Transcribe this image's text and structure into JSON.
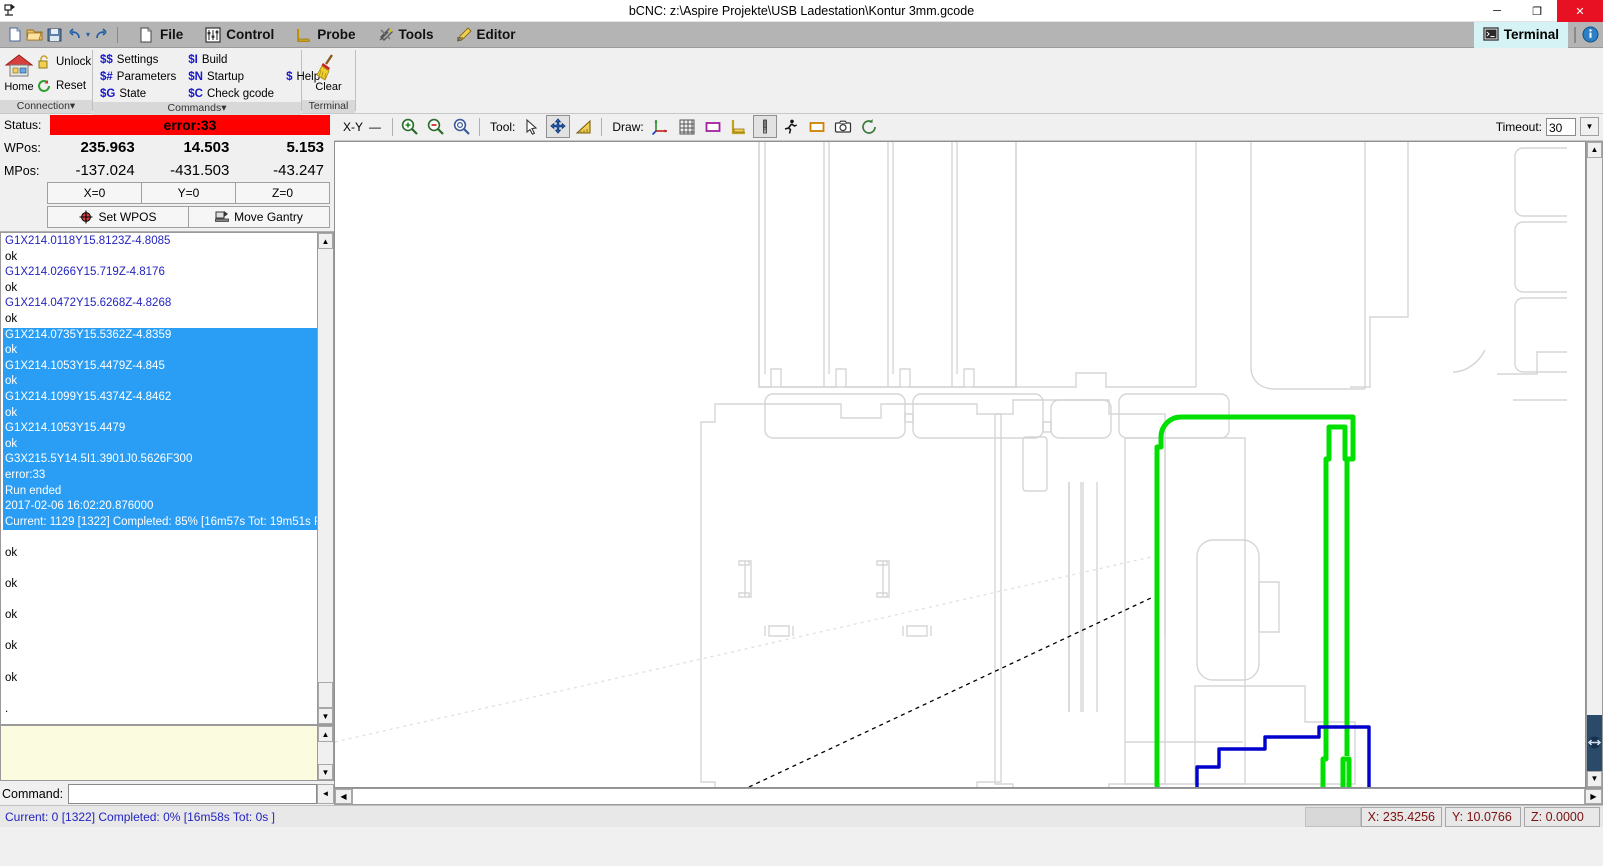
{
  "window": {
    "title": "bCNC: z:\\Aspire Projekte\\USB Ladestation\\Kontur 3mm.gcode",
    "minimize": "─",
    "maximize": "❐",
    "close": "✕"
  },
  "quick_access": {
    "new": "new-file",
    "open": "open-folder",
    "save": "save-disk",
    "undo": "undo-arrow",
    "undo_dropdown": "▾",
    "redo": "redo-arrow"
  },
  "menu_tabs": [
    {
      "label": "File",
      "icon": "page-icon"
    },
    {
      "label": "Control",
      "icon": "sliders-icon"
    },
    {
      "label": "Probe",
      "icon": "ruler-icon"
    },
    {
      "label": "Tools",
      "icon": "wrench-screwdriver-icon"
    },
    {
      "label": "Editor",
      "icon": "pencil-icon"
    }
  ],
  "terminal_tab": {
    "label": "Terminal",
    "icon": "terminal-icon",
    "info_icon": "info-icon"
  },
  "ribbon": {
    "connection": {
      "group_label": "Connection",
      "group_arrow": "▾",
      "home": "Home",
      "unlock": "Unlock",
      "reset": "Reset"
    },
    "commands": {
      "group_label": "Commands",
      "group_arrow": "▾",
      "items": [
        {
          "prefix": "$$",
          "label": "Settings"
        },
        {
          "prefix": "$#",
          "label": "Parameters"
        },
        {
          "prefix": "$G",
          "label": "State"
        },
        {
          "prefix": "$I",
          "label": "Build"
        },
        {
          "prefix": "$N",
          "label": "Startup"
        },
        {
          "prefix": "$C",
          "label": "Check gcode"
        },
        {
          "prefix": "$",
          "label": "Help"
        }
      ]
    },
    "terminal": {
      "group_label": "Terminal",
      "clear": "Clear"
    }
  },
  "status_panel": {
    "status_label": "Status:",
    "status_value": "error:33",
    "status_color": "#ff0000",
    "wpos_label": "WPos:",
    "wpos": [
      "235.963",
      "14.503",
      "5.153"
    ],
    "mpos_label": "MPos:",
    "mpos": [
      "-137.024",
      "-431.503",
      "-43.247"
    ],
    "zero_buttons": [
      "X=0",
      "Y=0",
      "Z=0"
    ],
    "set_wpos": "Set WPOS",
    "move_gantry": "Move Gantry"
  },
  "terminal_log": [
    {
      "text": "G1X214.0118Y15.8123Z-4.8085",
      "type": "gcode",
      "selected": false
    },
    {
      "text": "ok",
      "type": "ok",
      "selected": false
    },
    {
      "text": "G1X214.0266Y15.719Z-4.8176",
      "type": "gcode",
      "selected": false
    },
    {
      "text": "ok",
      "type": "ok",
      "selected": false
    },
    {
      "text": "G1X214.0472Y15.6268Z-4.8268",
      "type": "gcode",
      "selected": false
    },
    {
      "text": "ok",
      "type": "ok",
      "selected": false
    },
    {
      "text": "G1X214.0735Y15.5362Z-4.8359",
      "type": "gcode",
      "selected": true
    },
    {
      "text": "ok",
      "type": "ok",
      "selected": true
    },
    {
      "text": "G1X214.1053Y15.4479Z-4.845",
      "type": "gcode",
      "selected": true
    },
    {
      "text": "ok",
      "type": "ok",
      "selected": true
    },
    {
      "text": "G1X214.1099Y15.4374Z-4.8462",
      "type": "gcode",
      "selected": true
    },
    {
      "text": "ok",
      "type": "ok",
      "selected": true
    },
    {
      "text": "G1X214.1053Y15.4479",
      "type": "gcode",
      "selected": true
    },
    {
      "text": "ok",
      "type": "ok",
      "selected": true
    },
    {
      "text": "G3X215.5Y14.5I1.3901J0.5626F300",
      "type": "gcode",
      "selected": true
    },
    {
      "text": "error:33",
      "type": "error",
      "selected": true
    },
    {
      "text": "Run ended",
      "type": "info",
      "selected": true
    },
    {
      "text": "2017-02-06 16:02:20.876000",
      "type": "info",
      "selected": true
    },
    {
      "text": "Current: 1129 [1322]  Completed: 85% [16m57s Tot: 19m51s F",
      "type": "info",
      "selected": true
    },
    {
      "text": "",
      "type": "ok",
      "selected": false
    },
    {
      "text": "ok",
      "type": "ok",
      "selected": false
    },
    {
      "text": "",
      "type": "ok",
      "selected": false
    },
    {
      "text": "ok",
      "type": "ok",
      "selected": false
    },
    {
      "text": "",
      "type": "ok",
      "selected": false
    },
    {
      "text": "ok",
      "type": "ok",
      "selected": false
    },
    {
      "text": "",
      "type": "ok",
      "selected": false
    },
    {
      "text": "ok",
      "type": "ok",
      "selected": false
    },
    {
      "text": "",
      "type": "ok",
      "selected": false
    },
    {
      "text": "ok",
      "type": "ok",
      "selected": false
    },
    {
      "text": "",
      "type": "ok",
      "selected": false
    },
    {
      "text": ".",
      "type": "ok",
      "selected": false
    }
  ],
  "command_bar": {
    "label": "Command:",
    "value": "",
    "history_arrow": "◄"
  },
  "canvas_toolbar": {
    "view_label": "X-Y",
    "view_arrow": "—",
    "zoom_in": "zoom-in-icon",
    "zoom_out": "zoom-out-icon",
    "zoom_fit": "zoom-fit-icon",
    "tool_label": "Tool:",
    "tools": [
      {
        "name": "select-arrow-icon",
        "active": false
      },
      {
        "name": "pan-move-icon",
        "active": true
      },
      {
        "name": "ruler-triangle-icon",
        "active": false
      }
    ],
    "draw_label": "Draw:",
    "draw_items": [
      {
        "name": "axes-icon",
        "active": false
      },
      {
        "name": "grid-icon",
        "active": false
      },
      {
        "name": "margin-box-icon",
        "active": false
      },
      {
        "name": "ruler-corner-icon",
        "active": false
      },
      {
        "name": "endmill-icon",
        "active": true
      },
      {
        "name": "path-runner-icon",
        "active": false
      },
      {
        "name": "workarea-box-icon",
        "active": false
      },
      {
        "name": "camera-icon",
        "active": false
      },
      {
        "name": "arc-reverse-icon",
        "active": false
      }
    ],
    "timeout_label": "Timeout:",
    "timeout_value": "30",
    "timeout_arrow": "▼"
  },
  "status_bar": {
    "progress": "Current: 0 [1322]  Completed: 0% [16m58s Tot: 0s ]",
    "coords": [
      {
        "label": "X: 235.4256"
      },
      {
        "label": "Y: 10.0766"
      },
      {
        "label": "Z: 0.0000"
      }
    ]
  },
  "canvas_colors": {
    "geometry": "#d5d5d5",
    "completed_path": "#00e000",
    "active_path": "#0000cc",
    "rapid_move": "#000000",
    "marker": "#dd1111"
  }
}
